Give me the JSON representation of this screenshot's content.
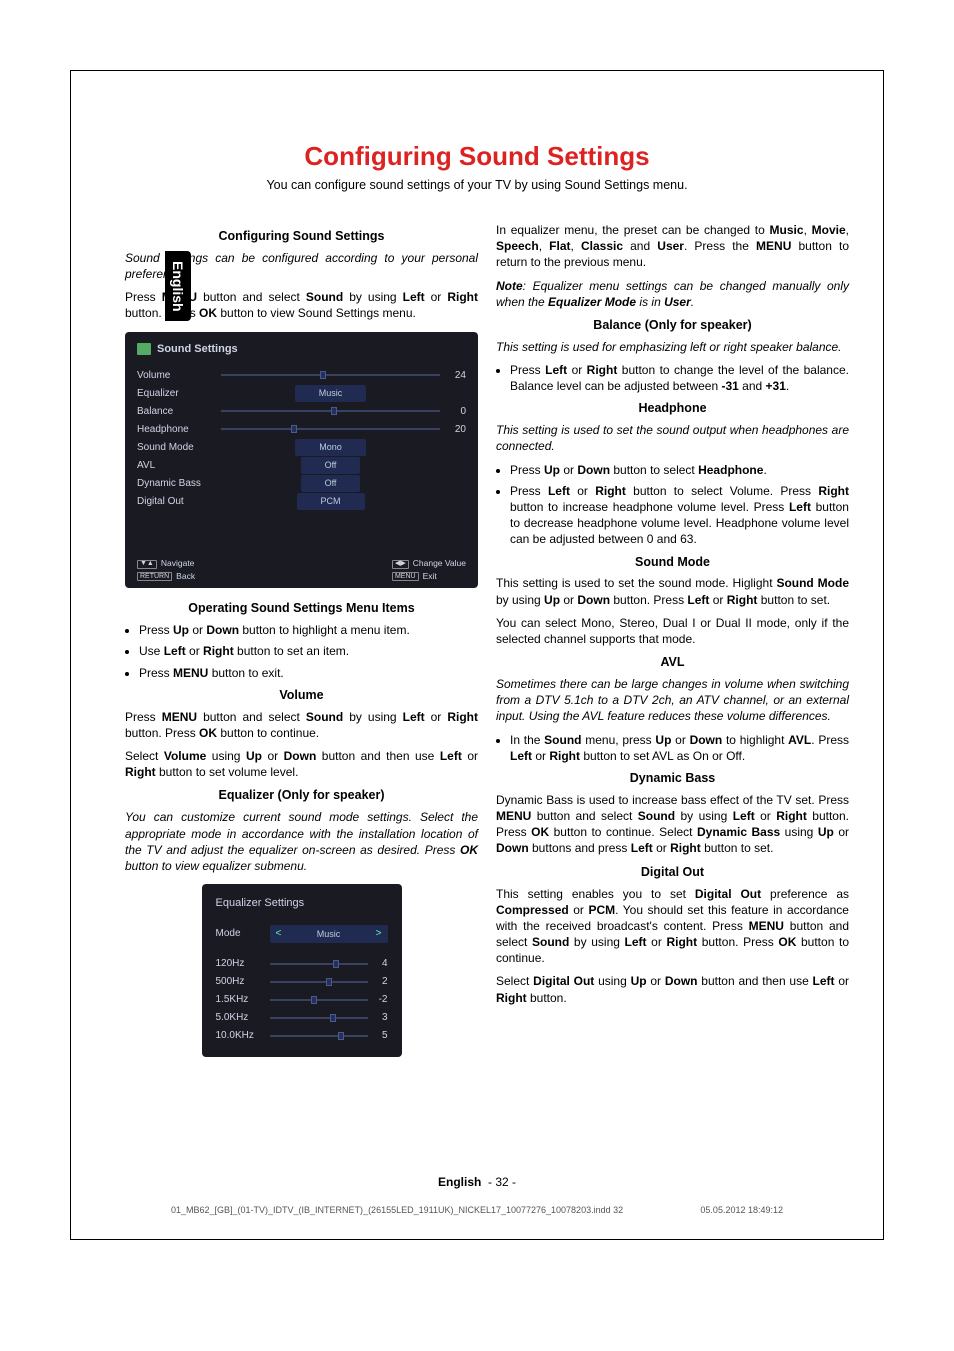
{
  "lang_tab": "English",
  "title": "Configuring Sound Settings",
  "subtitle": "You can configure sound settings of your TV by using Sound Settings menu.",
  "left": {
    "h1": "Configuring Sound Settings",
    "p1": "Sound settings can be configured according to your personal preferences.",
    "p2_a": "Press ",
    "p2_b": "MENU",
    "p2_c": " button and select ",
    "p2_d": "Sound",
    "p2_e": " by using ",
    "p2_f": "Left",
    "p2_g": " or ",
    "p2_h": "Right",
    "p2_i": " button. Press ",
    "p2_j": "OK",
    "p2_k": " button to view Sound Settings menu.",
    "osd": {
      "title": "Sound Settings",
      "rows": [
        {
          "label": "Volume",
          "type": "slider",
          "value": "24",
          "pos": 45
        },
        {
          "label": "Equalizer",
          "type": "pill",
          "value": "Music"
        },
        {
          "label": "Balance",
          "type": "slider",
          "value": "0",
          "pos": 50
        },
        {
          "label": "Headphone",
          "type": "slider",
          "value": "20",
          "pos": 32
        },
        {
          "label": "Sound Mode",
          "type": "pill",
          "value": "Mono"
        },
        {
          "label": "AVL",
          "type": "pill",
          "value": "Off"
        },
        {
          "label": "Dynamic Bass",
          "type": "pill",
          "value": "Off"
        },
        {
          "label": "Digital Out",
          "type": "pill",
          "value": "PCM"
        }
      ],
      "footer": {
        "nav_keys": "▼▲",
        "nav": "Navigate",
        "back_key": "RETURN",
        "back": "Back",
        "chg_keys": "◀▶",
        "chg": "Change Value",
        "exit_key": "MENU",
        "exit": "Exit"
      }
    },
    "h2": "Operating Sound Settings Menu Items",
    "li1_a": "Press ",
    "li1_b": "Up",
    "li1_c": " or ",
    "li1_d": "Down",
    "li1_e": " button to highlight a menu item.",
    "li2_a": "Use ",
    "li2_b": "Left",
    "li2_c": " or ",
    "li2_d": "Right",
    "li2_e": " button to set an item.",
    "li3_a": "Press ",
    "li3_b": "MENU",
    "li3_c": " button to exit.",
    "h3": "Volume",
    "p3_a": "Press ",
    "p3_b": "MENU",
    "p3_c": " button and select ",
    "p3_d": "Sound",
    "p3_e": " by using ",
    "p3_f": "Left",
    "p3_g": " or ",
    "p3_h": "Right",
    "p3_i": " button. Press ",
    "p3_j": "OK",
    "p3_k": " button to continue.",
    "p4_a": "Select ",
    "p4_b": "Volume",
    "p4_c": " using ",
    "p4_d": "Up",
    "p4_e": " or ",
    "p4_f": "Down",
    "p4_g": " button and then use ",
    "p4_h": "Left",
    "p4_i": " or ",
    "p4_j": "Right",
    "p4_k": " button to set volume level.",
    "h4": "Equalizer (Only for speaker)",
    "p5_a": "You can customize current sound mode settings. Select the appropriate mode in accordance with the installation location of the TV and adjust the equalizer on-screen as desired. Press ",
    "p5_b": "OK",
    "p5_c": " button to view equalizer submenu.",
    "eq": {
      "title": "Equalizer Settings",
      "mode_label": "Mode",
      "mode_value": "Music",
      "bands": [
        {
          "label": "120Hz",
          "value": "4",
          "pos": 65
        },
        {
          "label": "500Hz",
          "value": "2",
          "pos": 58
        },
        {
          "label": "1.5KHz",
          "value": "-2",
          "pos": 42
        },
        {
          "label": "5.0KHz",
          "value": "3",
          "pos": 62
        },
        {
          "label": "10.0KHz",
          "value": "5",
          "pos": 70
        }
      ]
    }
  },
  "right": {
    "p1_a": "In equalizer menu, the preset can be changed to ",
    "p1_b": "Music",
    "p1_c": ", ",
    "p1_d": "Movie",
    "p1_e": ", ",
    "p1_f": "Speech",
    "p1_g": ", ",
    "p1_h": "Flat",
    "p1_i": ", ",
    "p1_j": "Classic",
    "p1_k": " and ",
    "p1_l": "User",
    "p1_m": ". Press the ",
    "p1_n": "MENU",
    "p1_o": " button to return to the previous menu.",
    "note_a": "Note",
    "note_b": ": Equalizer menu settings can be changed manually only when the ",
    "note_c": "Equalizer Mode",
    "note_d": " is in ",
    "note_e": "User",
    "note_f": ".",
    "h1": "Balance (Only for speaker)",
    "p2": "This setting is used for emphasizing left or right speaker balance.",
    "li1_a": "Press ",
    "li1_b": "Left",
    "li1_c": " or ",
    "li1_d": "Right",
    "li1_e": " button to change the level of the balance. Balance level can be adjusted between ",
    "li1_f": "-31",
    "li1_g": " and ",
    "li1_h": "+31",
    "li1_i": ".",
    "h2": "Headphone",
    "p3": "This setting is used to set the sound output when headphones are connected.",
    "li2_a": "Press ",
    "li2_b": "Up",
    "li2_c": " or ",
    "li2_d": "Down",
    "li2_e": " button to select ",
    "li2_f": "Headphone",
    "li2_g": ".",
    "li3_a": "Press ",
    "li3_b": "Left",
    "li3_c": " or ",
    "li3_d": "Right",
    "li3_e": " button to select Volume. Press ",
    "li3_f": "Right",
    "li3_g": " button to increase headphone volume level. Press ",
    "li3_h": "Left",
    "li3_i": " button to decrease headphone volume level. Headphone volume level can be adjusted between 0 and 63.",
    "h3": "Sound Mode",
    "p4_a": "This setting is used to set the sound mode. Higlight ",
    "p4_b": "Sound Mode",
    "p4_c": " by using ",
    "p4_d": "Up",
    "p4_e": " or ",
    "p4_f": "Down",
    "p4_g": " button. Press ",
    "p4_h": "Left",
    "p4_i": " or ",
    "p4_j": "Right",
    "p4_k": " button to set.",
    "p5": "You can select Mono, Stereo, Dual I or Dual II mode, only if the selected channel supports that mode.",
    "h4": "AVL",
    "p6": "Sometimes there can be large changes in volume when switching from a DTV 5.1ch to a DTV 2ch, an ATV channel, or an external input. Using the AVL feature reduces these volume differences.",
    "li4_a": "In the ",
    "li4_b": "Sound",
    "li4_c": " menu, press ",
    "li4_d": "Up",
    "li4_e": " or ",
    "li4_f": "Down",
    "li4_g": " to highlight ",
    "li4_h": "AVL",
    "li4_i": ". Press ",
    "li4_j": "Left",
    "li4_k": " or ",
    "li4_l": "Right",
    "li4_m": " button to set AVL as On or Off.",
    "h5": "Dynamic Bass",
    "p7_a": "Dynamic Bass is used to increase bass effect of the TV set. Press ",
    "p7_b": "MENU",
    "p7_c": " button and select ",
    "p7_d": "Sound",
    "p7_e": " by using ",
    "p7_f": "Left",
    "p7_g": " or ",
    "p7_h": "Right",
    "p7_i": " button. Press ",
    "p7_j": "OK",
    "p7_k": " button to continue. Select ",
    "p7_l": "Dynamic Bass",
    "p7_m": " using ",
    "p7_n": "Up",
    "p7_o": " or ",
    "p7_p": "Down",
    "p7_q": " buttons and press ",
    "p7_r": "Left",
    "p7_s": " or ",
    "p7_t": "Right",
    "p7_u": " button to set.",
    "h6": "Digital Out",
    "p8_a": "This setting enables you to set ",
    "p8_b": "Digital Out",
    "p8_c": " preference as ",
    "p8_d": "Compressed",
    "p8_e": " or ",
    "p8_f": "PCM",
    "p8_g": ". You should set this feature in accordance with the received broadcast's content. Press ",
    "p8_h": "MENU",
    "p8_i": " button and select ",
    "p8_j": "Sound",
    "p8_k": " by using ",
    "p8_l": "Left",
    "p8_m": " or ",
    "p8_n": "Right",
    "p8_o": " button. Press ",
    "p8_p": "OK",
    "p8_q": " button to continue.",
    "p9_a": "Select ",
    "p9_b": "Digital Out",
    "p9_c": " using ",
    "p9_d": "Up",
    "p9_e": " or ",
    "p9_f": "Down",
    "p9_g": " button and then use ",
    "p9_h": "Left",
    "p9_i": " or ",
    "p9_j": "Right",
    "p9_k": " button."
  },
  "footer": {
    "lang": "English",
    "page": "- 32 -"
  },
  "imposition": {
    "file": "01_MB62_[GB]_(01-TV)_IDTV_(IB_INTERNET)_(26155LED_1911UK)_NICKEL17_10077276_10078203.indd   32",
    "date": "05.05.2012   18:49:12"
  }
}
